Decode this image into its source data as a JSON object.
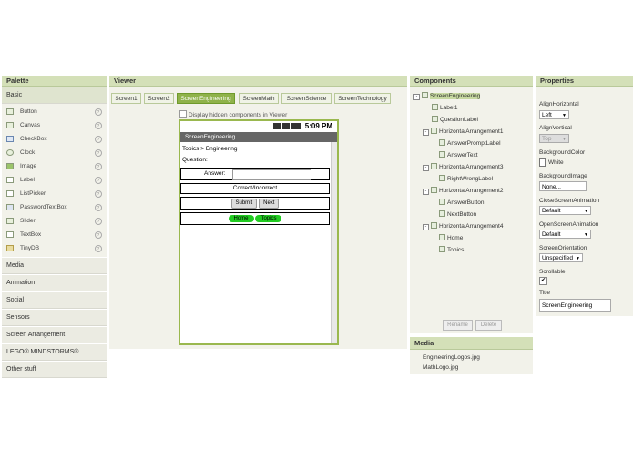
{
  "palette": {
    "header": "Palette",
    "sections": {
      "basic": "Basic",
      "media": "Media",
      "animation": "Animation",
      "social": "Social",
      "sensors": "Sensors",
      "screen_arrangement": "Screen Arrangement",
      "lego": "LEGO® MINDSTORMS®",
      "other": "Other stuff"
    },
    "items": [
      "Button",
      "Canvas",
      "CheckBox",
      "Clock",
      "Image",
      "Label",
      "ListPicker",
      "PasswordTextBox",
      "Slider",
      "TextBox",
      "TinyDB"
    ],
    "help_glyph": "?"
  },
  "viewer": {
    "header": "Viewer",
    "tabs": [
      "Screen1",
      "Screen2",
      "ScreenEngineering",
      "ScreenMath",
      "ScreenScience",
      "ScreenTechnology"
    ],
    "active_tab": "ScreenEngineering",
    "hidden_components_label": "Display hidden components in Viewer",
    "phone": {
      "time": "5:09 PM",
      "title": "ScreenEngineering",
      "topics_label": "Topics > Engineering",
      "question_label": "Question:",
      "answer_label": "Answer:",
      "correct_label": "Correct/Incorrect",
      "submit": "Submit",
      "next": "Next",
      "home": "Home",
      "topics": "Topics"
    }
  },
  "components": {
    "header": "Components",
    "tree": [
      {
        "label": "ScreenEngineering",
        "selected": true
      },
      {
        "label": "Label1"
      },
      {
        "label": "QuestionLabel"
      },
      {
        "label": "HorizontalArrangement1"
      },
      {
        "label": "AnswerPromptLabel"
      },
      {
        "label": "AnswerText"
      },
      {
        "label": "HorizontalArrangement3"
      },
      {
        "label": "RightWrongLabel"
      },
      {
        "label": "HorizontalArrangement2"
      },
      {
        "label": "AnswerButton"
      },
      {
        "label": "NextButton"
      },
      {
        "label": "HorizontalArrangement4"
      },
      {
        "label": "Home"
      },
      {
        "label": "Topics"
      }
    ],
    "tree_toggle": "-",
    "rename": "Rename",
    "delete": "Delete"
  },
  "media": {
    "header": "Media",
    "files": [
      "EngineeringLogos.jpg",
      "MathLogo.jpg"
    ]
  },
  "properties": {
    "header": "Properties",
    "align_horizontal_label": "AlignHorizontal",
    "align_horizontal_value": "Left",
    "align_vertical_label": "AlignVertical",
    "align_vertical_value": "Top",
    "background_color_label": "BackgroundColor",
    "background_color_value": "White",
    "background_image_label": "BackgroundImage",
    "background_image_value": "None...",
    "close_anim_label": "CloseScreenAnimation",
    "close_anim_value": "Default",
    "open_anim_label": "OpenScreenAnimation",
    "open_anim_value": "Default",
    "orientation_label": "ScreenOrientation",
    "orientation_value": "Unspecified",
    "scrollable_label": "Scrollable",
    "scrollable_checked": true,
    "check_glyph": "✔",
    "title_label": "Title",
    "title_value": "ScreenEngineering"
  },
  "colors": {
    "header_bg": "#d4e0b8",
    "active_tab": "#8fb24a",
    "green_button": "#22cc22",
    "phone_titlebar": "#666666"
  }
}
